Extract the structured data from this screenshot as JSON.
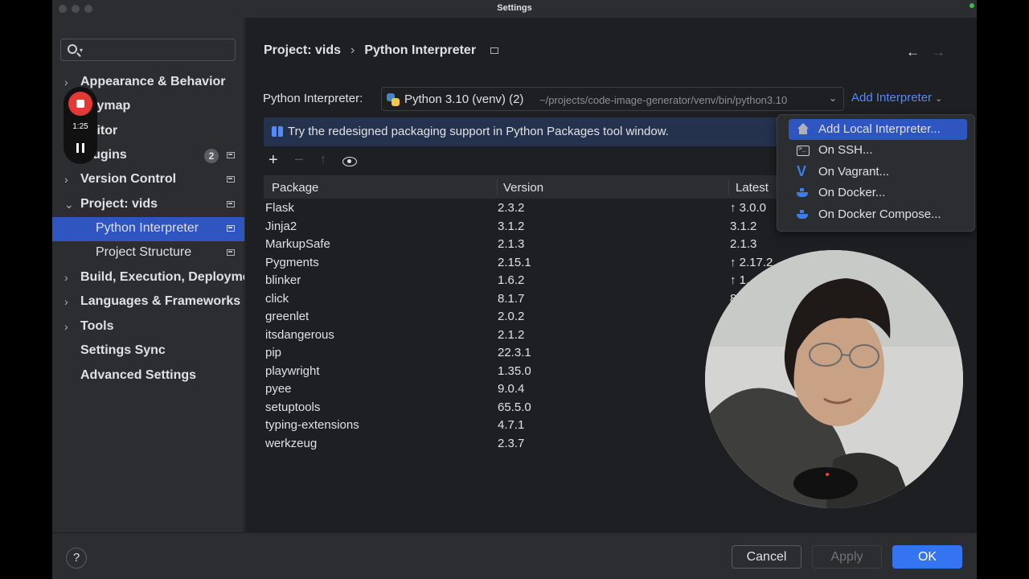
{
  "window": {
    "title": "Settings"
  },
  "search": {
    "placeholder": ""
  },
  "sidebar": {
    "items": [
      {
        "label": "Appearance & Behavior"
      },
      {
        "label": "Keymap"
      },
      {
        "label": "Editor"
      },
      {
        "label": "Plugins",
        "badge": "2"
      },
      {
        "label": "Version Control"
      },
      {
        "label": "Project: vids"
      },
      {
        "label": "Python Interpreter"
      },
      {
        "label": "Project Structure"
      },
      {
        "label": "Build, Execution, Deployment"
      },
      {
        "label": "Languages & Frameworks"
      },
      {
        "label": "Tools"
      },
      {
        "label": "Settings Sync"
      },
      {
        "label": "Advanced Settings"
      }
    ]
  },
  "recorder": {
    "time": "1:25"
  },
  "breadcrumb": {
    "project": "Project: vids",
    "page": "Python Interpreter"
  },
  "interpreter": {
    "label": "Python Interpreter:",
    "name": "Python 3.10 (venv) (2)",
    "path": "~/projects/code-image-generator/venv/bin/python3.10",
    "add_label": "Add Interpreter"
  },
  "banner": {
    "text": "Try the redesigned packaging support in Python Packages tool window."
  },
  "table": {
    "headers": [
      "Package",
      "Version",
      "Latest"
    ],
    "rows": [
      [
        "Flask",
        "2.3.2",
        "↑ 3.0.0"
      ],
      [
        "Jinja2",
        "3.1.2",
        "3.1.2"
      ],
      [
        "MarkupSafe",
        "2.1.3",
        "2.1.3"
      ],
      [
        "Pygments",
        "2.15.1",
        "↑ 2.17.2"
      ],
      [
        "blinker",
        "1.6.2",
        "↑ 1."
      ],
      [
        "click",
        "8.1.7",
        "8."
      ],
      [
        "greenlet",
        "2.0.2",
        ""
      ],
      [
        "itsdangerous",
        "2.1.2",
        ""
      ],
      [
        "pip",
        "22.3.1",
        ""
      ],
      [
        "playwright",
        "1.35.0",
        ""
      ],
      [
        "pyee",
        "9.0.4",
        ""
      ],
      [
        "setuptools",
        "65.5.0",
        ""
      ],
      [
        "typing-extensions",
        "4.7.1",
        ""
      ],
      [
        "werkzeug",
        "2.3.7",
        ""
      ]
    ]
  },
  "menu": {
    "items": [
      {
        "label": "Add Local Interpreter...",
        "icon": "home-icon"
      },
      {
        "label": "On SSH...",
        "icon": "terminal-icon"
      },
      {
        "label": "On Vagrant...",
        "icon": "vagrant-icon"
      },
      {
        "label": "On Docker...",
        "icon": "docker-icon"
      },
      {
        "label": "On Docker Compose...",
        "icon": "docker-icon"
      }
    ]
  },
  "footer": {
    "help": "?",
    "cancel": "Cancel",
    "apply": "Apply",
    "ok": "OK"
  },
  "colors": {
    "accent": "#3574f0",
    "selection": "#2e55c0",
    "link": "#548af7",
    "record": "#e53935"
  }
}
